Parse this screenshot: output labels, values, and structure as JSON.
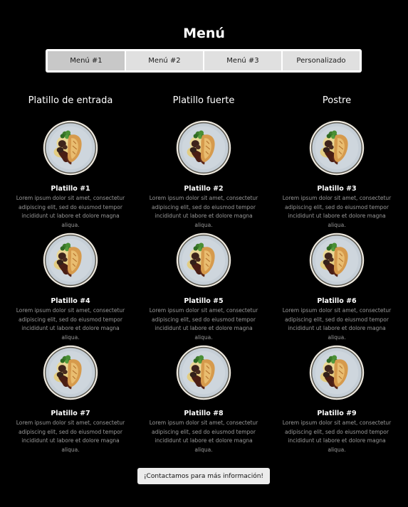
{
  "title": "Menú",
  "tabs": [
    {
      "label": "Menú #1",
      "active": true
    },
    {
      "label": "Menú #2",
      "active": false
    },
    {
      "label": "Menú #3",
      "active": false
    },
    {
      "label": "Personalizado",
      "active": false
    }
  ],
  "columns": [
    "Platillo de entrada",
    "Platillo fuerte",
    "Postre"
  ],
  "dishes": [
    {
      "name": "Platillo #1",
      "description": "Lorem ipsum dolor sit amet, consectetur adipiscing elit, sed do eiusmod tempor incididunt ut labore et dolore magna aliqua.",
      "image": "plated-chicken-dish-image"
    },
    {
      "name": "Platillo #2",
      "description": "Lorem ipsum dolor sit amet, consectetur adipiscing elit, sed do eiusmod tempor incididunt ut labore et dolore magna aliqua.",
      "image": "plated-chicken-dish-image"
    },
    {
      "name": "Platillo #3",
      "description": "Lorem ipsum dolor sit amet, consectetur adipiscing elit, sed do eiusmod tempor incididunt ut labore et dolore magna aliqua.",
      "image": "plated-chicken-dish-image"
    },
    {
      "name": "Platillo #4",
      "description": "Lorem ipsum dolor sit amet, consectetur adipiscing elit, sed do eiusmod tempor incididunt ut labore et dolore magna aliqua.",
      "image": "plated-chicken-dish-image"
    },
    {
      "name": "Platillo #5",
      "description": "Lorem ipsum dolor sit amet, consectetur adipiscing elit, sed do eiusmod tempor incididunt ut labore et dolore magna aliqua.",
      "image": "plated-chicken-dish-image"
    },
    {
      "name": "Platillo #6",
      "description": "Lorem ipsum dolor sit amet, consectetur adipiscing elit, sed do eiusmod tempor incididunt ut labore et dolore magna aliqua.",
      "image": "plated-chicken-dish-image"
    },
    {
      "name": "Platillo #7",
      "description": "Lorem ipsum dolor sit amet, consectetur adipiscing elit, sed do eiusmod tempor incididunt ut labore et dolore magna aliqua.",
      "image": "plated-chicken-dish-image"
    },
    {
      "name": "Platillo #8",
      "description": "Lorem ipsum dolor sit amet, consectetur adipiscing elit, sed do eiusmod tempor incididunt ut labore et dolore magna aliqua.",
      "image": "plated-chicken-dish-image"
    },
    {
      "name": "Platillo #9",
      "description": "Lorem ipsum dolor sit amet, consectetur adipiscing elit, sed do eiusmod tempor incididunt ut labore et dolore magna aliqua.",
      "image": "plated-chicken-dish-image"
    }
  ],
  "cta": {
    "label": "¡Contactamos para más información!"
  },
  "colors": {
    "background": "#000000",
    "tab_bar": "#ffffff",
    "tab_inactive": "#e0e0e0",
    "tab_active": "#c8c8c8",
    "text_primary": "#ffffff",
    "text_secondary": "#9a9a9a",
    "button_bg": "#ececec"
  }
}
